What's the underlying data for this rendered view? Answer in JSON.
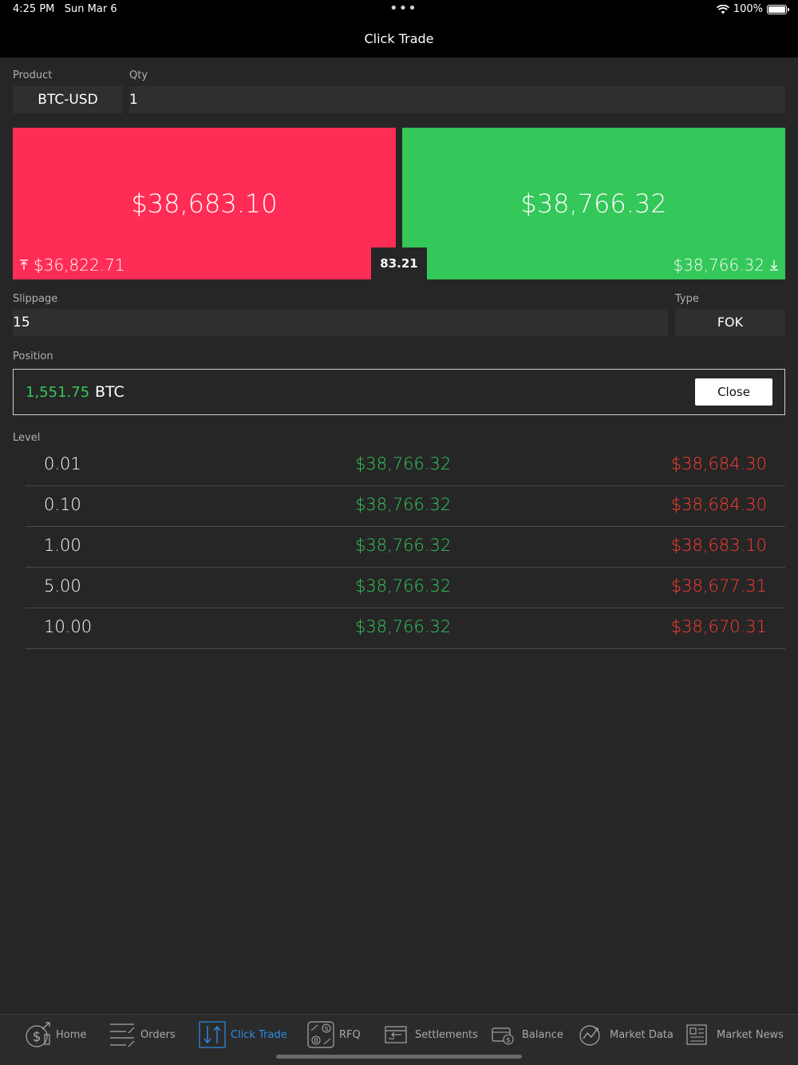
{
  "status": {
    "time": "4:25 PM",
    "date": "Sun Mar 6",
    "dots": "•••",
    "battery": "100%"
  },
  "nav": {
    "title": "Click Trade"
  },
  "form": {
    "product_label": "Product",
    "product_value": "BTC-USD",
    "qty_label": "Qty",
    "qty_value": "1",
    "slippage_label": "Slippage",
    "slippage_value": "15",
    "type_label": "Type",
    "type_value": "FOK"
  },
  "bid": {
    "price": "$38,683.10",
    "sub_price": "$36,822.71",
    "color": "#ff2d55"
  },
  "ask": {
    "price": "$38,766.32",
    "sub_price": "$38,766.32",
    "color": "#34c759"
  },
  "spread": "83.21",
  "position": {
    "label": "Position",
    "qty": "1,551.75",
    "asset": "BTC",
    "close_label": "Close"
  },
  "levels_label": "Level",
  "levels": [
    {
      "level": "0.01",
      "buy": "$38,766.32",
      "sell": "$38,684.30"
    },
    {
      "level": "0.10",
      "buy": "$38,766.32",
      "sell": "$38,684.30"
    },
    {
      "level": "1.00",
      "buy": "$38,766.32",
      "sell": "$38,683.10"
    },
    {
      "level": "5.00",
      "buy": "$38,766.32",
      "sell": "$38,677.31"
    },
    {
      "level": "10.00",
      "buy": "$38,766.32",
      "sell": "$38,670.31"
    }
  ],
  "tabs": [
    {
      "label": "Home",
      "icon": "home-dollar-icon"
    },
    {
      "label": "Orders",
      "icon": "orders-icon"
    },
    {
      "label": "Click Trade",
      "icon": "click-trade-icon",
      "active": true
    },
    {
      "label": "RFQ",
      "icon": "rfq-icon"
    },
    {
      "label": "Settlements",
      "icon": "settlements-icon"
    },
    {
      "label": "Balance",
      "icon": "balance-icon"
    },
    {
      "label": "Market Data",
      "icon": "market-data-icon"
    },
    {
      "label": "Market News",
      "icon": "market-news-icon"
    }
  ],
  "colors": {
    "accent": "#2b8ce6",
    "buy": "#34c759",
    "sell": "#ff3b30"
  }
}
